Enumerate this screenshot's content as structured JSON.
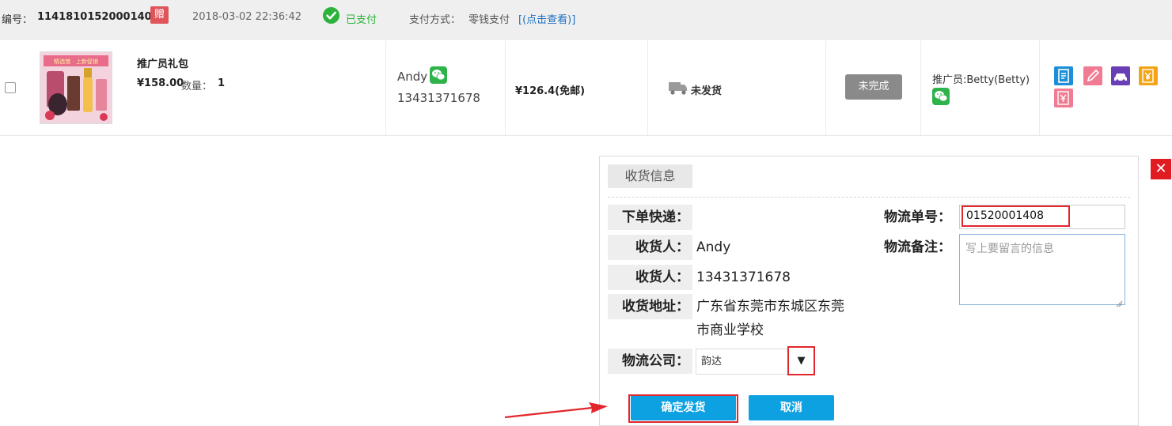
{
  "order_header": {
    "order_no_label": "编号：",
    "order_no": "11418101520001408",
    "gift_badge": "赠",
    "order_time": "2018-03-02 22:36:42",
    "paid_status": "已支付",
    "pay_method_label": "支付方式：",
    "pay_method": "零钱支付",
    "pay_view_link": "[(点击查看)]"
  },
  "order_row": {
    "product_name": "推广员礼包",
    "product_price": "¥158.00",
    "qty_label": "数量：",
    "qty": "1",
    "buyer_name": "Andy",
    "buyer_phone": "13431371678",
    "order_total": "¥126.4(免邮)",
    "ship_status": "未发货",
    "incomplete_button": "未完成",
    "promoter": "推广员:Betty(Betty)",
    "action_icons": [
      "note-icon",
      "edit-icon",
      "car-icon",
      "yen-icon",
      "refund-icon"
    ],
    "thumb_banner": "精选馆 · 上新促销"
  },
  "shipping_panel": {
    "title": "收货信息",
    "labels": {
      "courier": "下单快递：",
      "receiver": "收货人：",
      "receiver_phone": "收货人：",
      "address": "收货地址：",
      "carrier": "物流公司：",
      "tracking_no": "物流单号：",
      "remark": "物流备注："
    },
    "values": {
      "courier": "",
      "receiver": "Andy",
      "receiver_phone": "13431371678",
      "address_line1": "广东省东莞市东城区东莞",
      "address_line2": "市商业学校",
      "carrier": "韵达",
      "carrier_arrow": "▼",
      "tracking_no": "01520001408",
      "remark_placeholder": "写上要留言的信息"
    },
    "confirm_button": "确定发货",
    "cancel_button": "取消",
    "close_glyph": "✕"
  },
  "colors": {
    "accent_blue": "#0ea1e2",
    "highlight_red": "#e2262c",
    "paid_green": "#2bb33c",
    "wechat_green": "#2eb34b"
  }
}
